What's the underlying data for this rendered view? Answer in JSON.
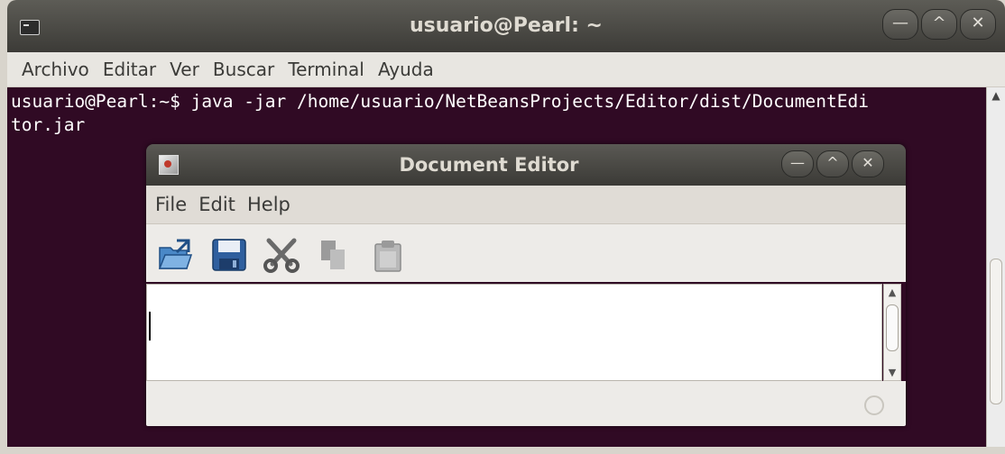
{
  "terminal": {
    "title": "usuario@Pearl: ~",
    "menu": [
      "Archivo",
      "Editar",
      "Ver",
      "Buscar",
      "Terminal",
      "Ayuda"
    ],
    "lines": [
      "usuario@Pearl:~$ java -jar /home/usuario/NetBeansProjects/Editor/dist/DocumentEdi",
      "tor.jar"
    ],
    "window_buttons": {
      "minimize": "—",
      "maximize": "^",
      "close": "✕"
    },
    "background_color": "#300a24"
  },
  "editor": {
    "title": "Document Editor",
    "menu": [
      "File",
      "Edit",
      "Help"
    ],
    "window_buttons": {
      "minimize": "—",
      "maximize": "^",
      "close": "✕"
    },
    "toolbar": [
      {
        "icon": "open-icon",
        "enabled": true
      },
      {
        "icon": "save-icon",
        "enabled": true
      },
      {
        "icon": "cut-icon",
        "enabled": true
      },
      {
        "icon": "copy-icon",
        "enabled": false
      },
      {
        "icon": "paste-icon",
        "enabled": false
      }
    ],
    "text_content": ""
  }
}
